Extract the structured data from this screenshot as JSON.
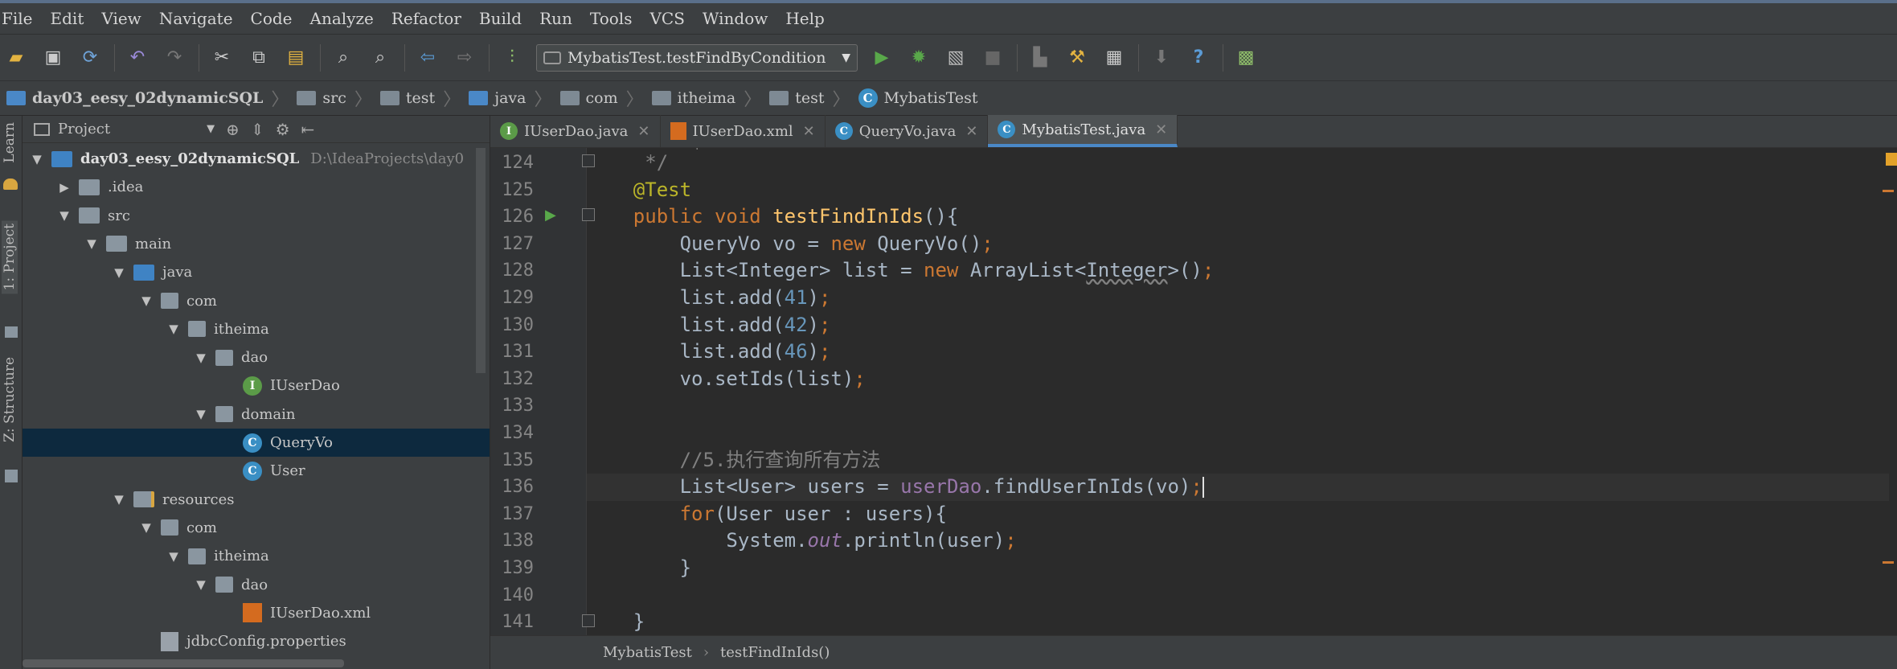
{
  "menu": [
    "File",
    "Edit",
    "View",
    "Navigate",
    "Code",
    "Analyze",
    "Refactor",
    "Build",
    "Run",
    "Tools",
    "VCS",
    "Window",
    "Help"
  ],
  "toolbar": {
    "run_config": "MybatisTest.testFindByCondition",
    "icons": [
      "open-icon",
      "save-icon",
      "sync-icon",
      "undo-icon",
      "redo-icon",
      "cut-icon",
      "copy-icon",
      "paste-icon",
      "find-icon",
      "replace-icon",
      "back-icon",
      "forward-icon",
      "build-icon",
      "run-icon",
      "debug-icon",
      "coverage-icon",
      "stop-icon",
      "attach-icon",
      "project-structure-icon",
      "sdk-icon",
      "vcs-icon",
      "help-icon",
      "sync-project-icon"
    ]
  },
  "breadcrumb": [
    "day03_eesy_02dynamicSQL",
    "src",
    "test",
    "java",
    "com",
    "itheima",
    "test",
    "MybatisTest"
  ],
  "side_tabs": {
    "learn": "Learn",
    "project": "1: Project",
    "structure": "Z: Structure"
  },
  "project_panel": {
    "title": "Project",
    "root_path": "D:\\IdeaProjects\\day0",
    "tree": [
      {
        "label": "day03_eesy_02dynamicSQL",
        "depth": 0,
        "arrow": "▼",
        "icon": "module",
        "bold": true
      },
      {
        "label": ".idea",
        "depth": 1,
        "arrow": "▶",
        "icon": "folder"
      },
      {
        "label": "src",
        "depth": 1,
        "arrow": "▼",
        "icon": "folder"
      },
      {
        "label": "main",
        "depth": 2,
        "arrow": "▼",
        "icon": "folder"
      },
      {
        "label": "java",
        "depth": 3,
        "arrow": "▼",
        "icon": "folder-blue"
      },
      {
        "label": "com",
        "depth": 4,
        "arrow": "▼",
        "icon": "package"
      },
      {
        "label": "itheima",
        "depth": 5,
        "arrow": "▼",
        "icon": "package"
      },
      {
        "label": "dao",
        "depth": 6,
        "arrow": "▼",
        "icon": "package"
      },
      {
        "label": "IUserDao",
        "depth": 7,
        "arrow": "",
        "icon": "interface"
      },
      {
        "label": "domain",
        "depth": 6,
        "arrow": "▼",
        "icon": "package"
      },
      {
        "label": "QueryVo",
        "depth": 7,
        "arrow": "",
        "icon": "class",
        "selected": true
      },
      {
        "label": "User",
        "depth": 7,
        "arrow": "",
        "icon": "class"
      },
      {
        "label": "resources",
        "depth": 3,
        "arrow": "▼",
        "icon": "resources"
      },
      {
        "label": "com",
        "depth": 4,
        "arrow": "▼",
        "icon": "package"
      },
      {
        "label": "itheima",
        "depth": 5,
        "arrow": "▼",
        "icon": "package"
      },
      {
        "label": "dao",
        "depth": 6,
        "arrow": "▼",
        "icon": "package"
      },
      {
        "label": "IUserDao.xml",
        "depth": 7,
        "arrow": "",
        "icon": "xml"
      },
      {
        "label": "jdbcConfig.properties",
        "depth": 4,
        "arrow": "",
        "icon": "properties"
      }
    ]
  },
  "tabs": [
    {
      "label": "IUserDao.java",
      "icon": "I"
    },
    {
      "label": "IUserDao.xml",
      "icon": "xml"
    },
    {
      "label": "QueryVo.java",
      "icon": "C"
    },
    {
      "label": "MybatisTest.java",
      "icon": "C",
      "active": true
    }
  ],
  "editor": {
    "lines": [
      124,
      125,
      126,
      127,
      128,
      129,
      130,
      131,
      132,
      133,
      134,
      135,
      136,
      137,
      138,
      139,
      140,
      141
    ],
    "current_line": 136
  },
  "status": {
    "class": "MybatisTest",
    "method": "testFindInIds()"
  }
}
